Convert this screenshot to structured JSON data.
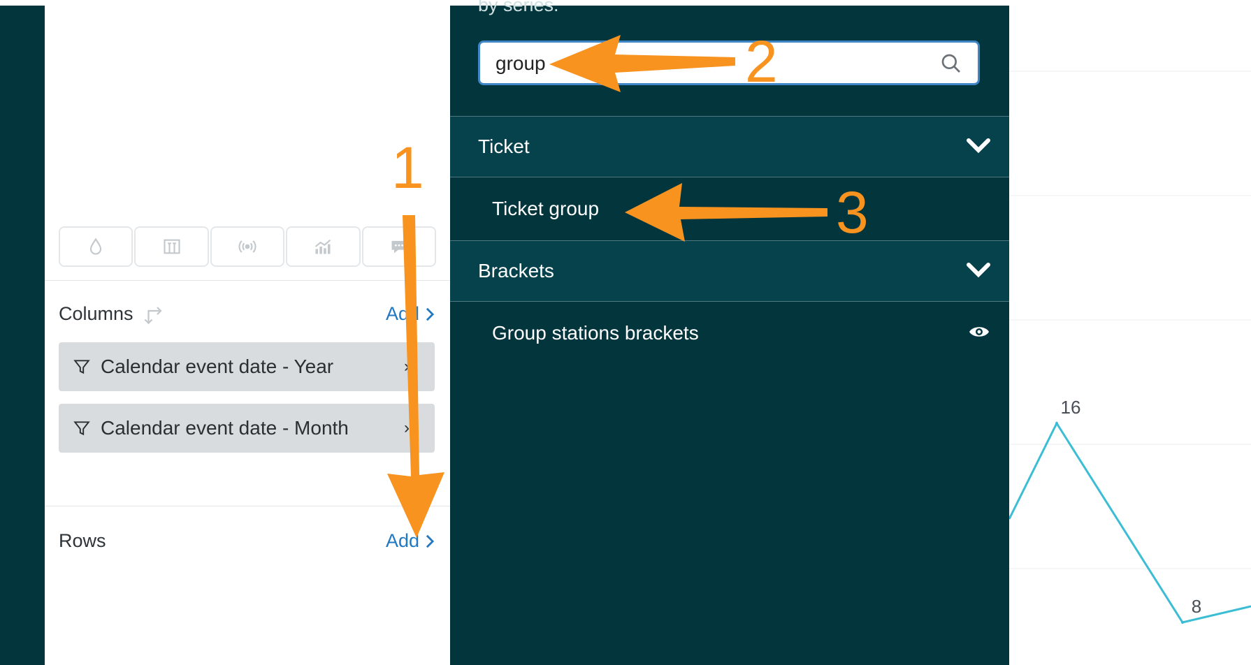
{
  "colors": {
    "dark_teal": "#03353d",
    "header_teal": "#05424c",
    "link_blue": "#1f78c1",
    "chip_gray": "#d8dcdf",
    "annotation_orange": "#f7931e",
    "chart_line": "#3bbdd4"
  },
  "config": {
    "viz_buttons": [
      {
        "icon": "drop-icon"
      },
      {
        "icon": "bar-compare-icon"
      },
      {
        "icon": "broadcast-icon"
      },
      {
        "icon": "trend-chart-icon"
      },
      {
        "icon": "comment-icon"
      }
    ],
    "columns": {
      "label": "Columns",
      "swap_icon": "swap-arrows-icon",
      "add_label": "Add",
      "chips": [
        {
          "label": "Calendar event date - Year"
        },
        {
          "label": "Calendar event date - Month"
        }
      ]
    },
    "rows": {
      "label": "Rows",
      "add_label": "Add"
    }
  },
  "dropdown": {
    "hint_text": "by series.",
    "search": {
      "value": "group",
      "icon": "search-icon"
    },
    "groups": [
      {
        "title": "Ticket",
        "options": [
          {
            "label": "Ticket group"
          }
        ]
      },
      {
        "title": "Brackets",
        "options": [
          {
            "label": "Group stations brackets",
            "icon": "eye-icon"
          }
        ]
      }
    ]
  },
  "chart_data": {
    "type": "line",
    "points": [
      {
        "label": "16",
        "value": 16
      },
      {
        "label": "8",
        "value": 8
      }
    ],
    "grid": true
  },
  "annotations": {
    "step1": "1",
    "step2": "2",
    "step3": "3"
  }
}
